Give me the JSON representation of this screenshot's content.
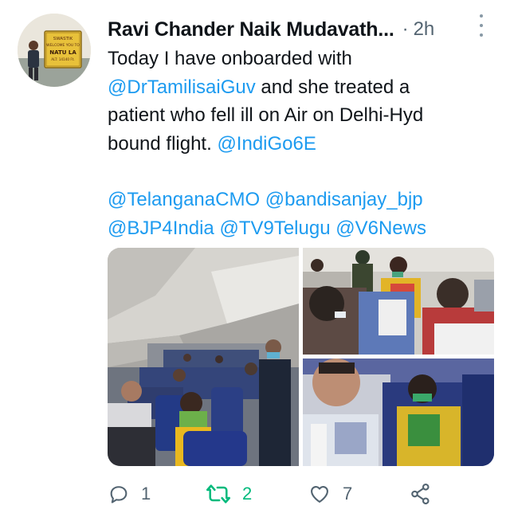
{
  "author": {
    "name": "Ravi Chander Naik Mudavath...",
    "separator": "·",
    "time": "2h"
  },
  "avatar": {
    "sign_lines": [
      "SWASTIK",
      "WELCOME YOU TO",
      "NATU LA",
      "ALT: 14140 Ft."
    ]
  },
  "tweet": {
    "para1": [
      {
        "t": "Today I have onboarded with",
        "m": false
      },
      {
        "t": "@DrTamilisaiGuv",
        "m": true
      },
      {
        "t": " and she treated a",
        "m": false
      },
      {
        "t": "patient who fell ill on Air on Delhi-Hyd",
        "m": false
      },
      {
        "t": "bound flight. ",
        "m": false
      },
      {
        "t": "@IndiGo6E",
        "m": true
      }
    ],
    "para2": [
      {
        "t": "@TelanganaCMO",
        "m": true
      },
      {
        "t": " ",
        "m": false
      },
      {
        "t": "@bandisanjay_bjp",
        "m": true
      },
      {
        "t": "@BJP4India",
        "m": true
      },
      {
        "t": " ",
        "m": false
      },
      {
        "t": "@TV9Telugu",
        "m": true
      },
      {
        "t": " ",
        "m": false
      },
      {
        "t": "@V6News",
        "m": true
      }
    ]
  },
  "photos": [
    "aircraft-cabin-photo",
    "passengers-photo",
    "seated-passengers-photo"
  ],
  "actions": {
    "reply": {
      "icon": "reply-icon",
      "count": "1"
    },
    "retweet": {
      "icon": "retweet-icon",
      "count": "2",
      "color": "#00ba7c"
    },
    "like": {
      "icon": "heart-icon",
      "count": "7"
    },
    "share": {
      "icon": "share-icon"
    }
  },
  "colors": {
    "mention": "#1d9bf0",
    "muted": "#536471"
  }
}
